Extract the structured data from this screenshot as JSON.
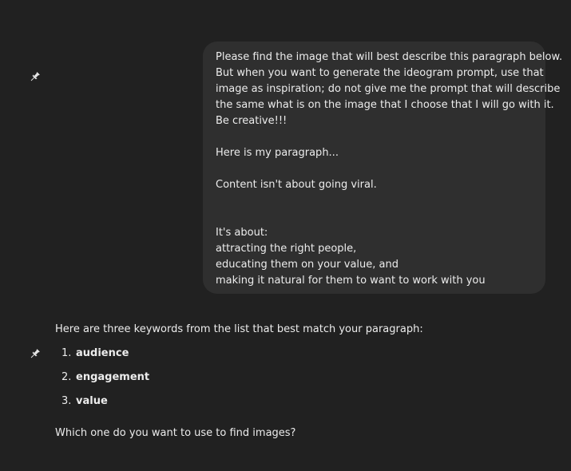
{
  "user_message": {
    "lines": [
      "Please find the image that will best describe this paragraph below.",
      "But when you want to generate the ideogram prompt, use that",
      "image as inspiration; do not give me the prompt that will describe",
      "the same what is on the image that I choose that I will go with it.",
      "Be creative!!!",
      "",
      "Here is my paragraph...",
      "",
      "Content isn't about going viral.",
      "",
      "",
      "It's about:",
      "attracting the right people,",
      "educating them on your value, and",
      "making it natural for them to want to work with you"
    ]
  },
  "assistant_message": {
    "intro": "Here are three keywords from the list that best match your paragraph:",
    "keywords": [
      {
        "num": "1.",
        "text": "audience"
      },
      {
        "num": "2.",
        "text": "engagement"
      },
      {
        "num": "3.",
        "text": "value"
      }
    ],
    "outro": "Which one do you want to use to find images?"
  },
  "icons": {
    "pin": "pin-icon"
  },
  "colors": {
    "background": "#212121",
    "bubble": "#2f2f2f",
    "text": "#ececec"
  }
}
